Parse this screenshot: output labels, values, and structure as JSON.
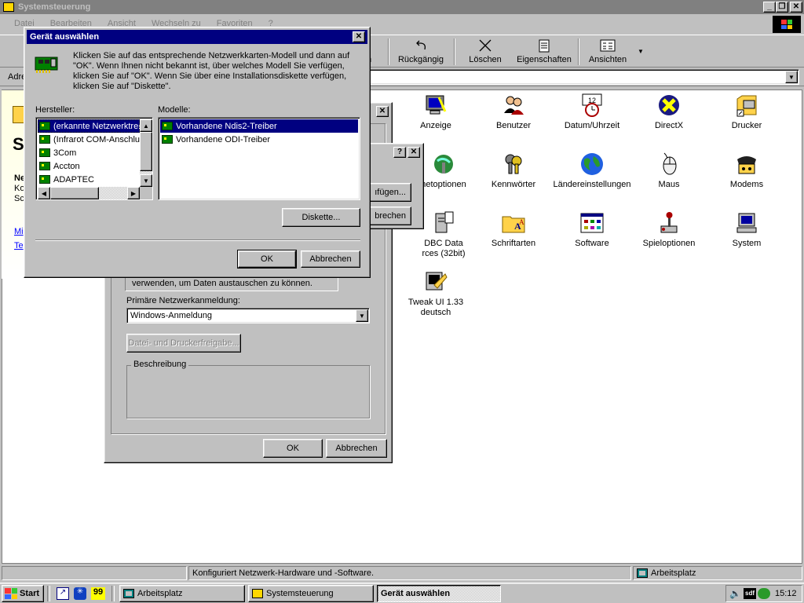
{
  "main_window": {
    "title": "Systemsteuerung",
    "menu": [
      "Datei",
      "Bearbeiten",
      "Ansicht",
      "Wechseln zu",
      "Favoriten",
      "?"
    ],
    "toolbar": {
      "cut_label_partial": "n",
      "undo": "Rückgängig",
      "delete": "Löschen",
      "properties": "Eigenschaften",
      "views": "Ansichten"
    },
    "address_label": "Adre",
    "left_panel": {
      "title_partial": "S",
      "lines": [
        "Ne",
        "Ko",
        "Sc"
      ],
      "links": [
        "Mi",
        "Te"
      ]
    },
    "icons": [
      {
        "label": "Anzeige",
        "icon": "display-icon"
      },
      {
        "label": "Benutzer",
        "icon": "users-icon"
      },
      {
        "label": "Datum/Uhrzeit",
        "icon": "clock-calendar-icon"
      },
      {
        "label": "DirectX",
        "icon": "directx-icon"
      },
      {
        "label": "Drucker",
        "icon": "printer-icon"
      },
      {
        "label": "netoptionen",
        "icon": "internet-options-icon"
      },
      {
        "label": "Kennwörter",
        "icon": "keys-icon"
      },
      {
        "label": "Ländereinstellungen",
        "icon": "globe-icon"
      },
      {
        "label": "Maus",
        "icon": "mouse-icon"
      },
      {
        "label": "Modems",
        "icon": "modem-icon"
      },
      {
        "label": "DBC Data",
        "label2": "rces (32bit)",
        "icon": "odbc-icon"
      },
      {
        "label": "Schriftarten",
        "icon": "fonts-folder-icon"
      },
      {
        "label": "Software",
        "icon": "software-icon"
      },
      {
        "label": "Spieloptionen",
        "icon": "joystick-icon"
      },
      {
        "label": "System",
        "icon": "computer-icon"
      },
      {
        "label": "Tweak UI 1.33",
        "label2": "deutsch",
        "icon": "tweakui-icon"
      }
    ],
    "status_text": "Konfiguriert Netzwerk-Hardware und -Software.",
    "status_zone": "Arbeitsplatz"
  },
  "network_dialog": {
    "info_text": "verwenden, um Daten austauschen zu können.",
    "primary_logon_label": "Primäre Netzwerkanmeldung:",
    "primary_logon_value": "Windows-Anmeldung",
    "file_print_button": "Datei- und Druckerfreigabe...",
    "description_label": "Beschreibung",
    "ok": "OK",
    "cancel": "Abbrechen"
  },
  "middle_dialog": {
    "add_partial": "ıfügen...",
    "cancel_partial": "brechen"
  },
  "select_device_dialog": {
    "title": "Gerät auswählen",
    "instructions": [
      "Klicken Sie auf das entsprechende Netzwerkkarten-Modell und dann auf",
      "\"OK\". Wenn Ihnen nicht bekannt ist, über welches Modell Sie verfügen,",
      "klicken Sie auf \"OK\".  Wenn Sie über eine Installationsdiskette verfügen,",
      "klicken Sie auf \"Diskette\"."
    ],
    "manufacturers_label": "Hersteller:",
    "manufacturers": [
      "(erkannte Netzwerktreib",
      "(Infrarot COM-Anschluss",
      "3Com",
      "Accton",
      "ADAPTEC"
    ],
    "models_label": "Modelle:",
    "models": [
      "Vorhandene Ndis2-Treiber",
      "Vorhandene ODI-Treiber"
    ],
    "disk_button": "Diskette...",
    "ok": "OK",
    "cancel": "Abbrechen"
  },
  "taskbar": {
    "start": "Start",
    "tasks": [
      "Arbeitsplatz",
      "Systemsteuerung",
      "Gerät auswählen"
    ],
    "tray_badge": "sdf",
    "clock": "15:12"
  },
  "colors": {
    "title_active": "#000080",
    "title_inactive": "#808080",
    "face": "#c0c0c0",
    "selection": "#000080"
  }
}
